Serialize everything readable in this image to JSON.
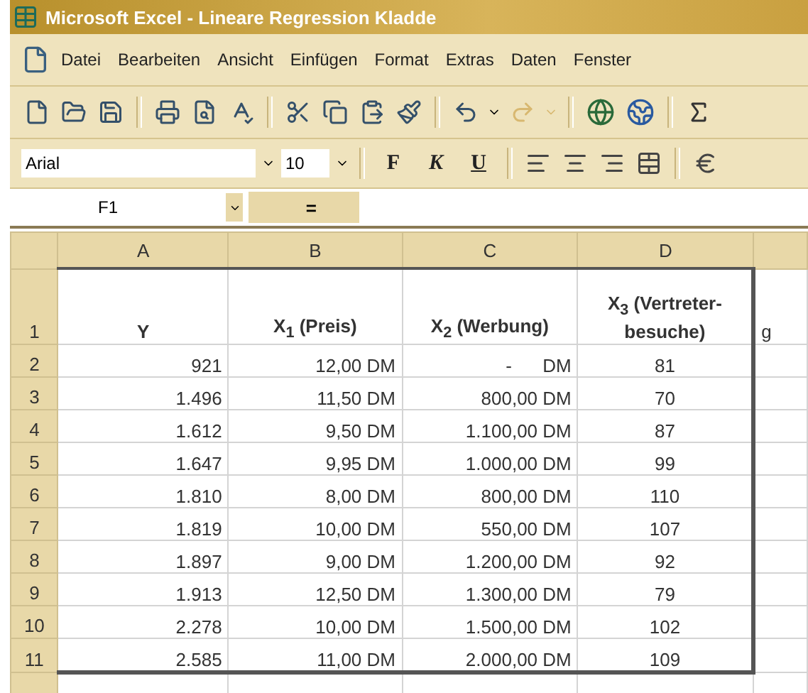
{
  "window": {
    "title": "Microsoft Excel - Lineare Regression Kladde"
  },
  "menu": [
    "Datei",
    "Bearbeiten",
    "Ansicht",
    "Einfügen",
    "Format",
    "Extras",
    "Daten",
    "Fenster"
  ],
  "standard_toolbar": {
    "redo": {
      "disabled": true
    }
  },
  "format_toolbar": {
    "font": "Arial",
    "size": "10",
    "bold": "F",
    "italic": "K",
    "underline": "U"
  },
  "formula_bar": {
    "name_box": "F1",
    "equals": "="
  },
  "sheet": {
    "columns": [
      "A",
      "B",
      "C",
      "D",
      ""
    ],
    "header_row": {
      "number": "1",
      "cells": [
        "Y",
        "X$_{1}$ (Preis)",
        "X$_{2}$ (Werbung)",
        "X$_{3}$ (Vertreter-besuche)",
        "g"
      ]
    },
    "rows": [
      {
        "number": "2",
        "cells": [
          "921",
          "12,00 DM",
          "-      DM",
          "81"
        ]
      },
      {
        "number": "3",
        "cells": [
          "1.496",
          "11,50 DM",
          "800,00 DM",
          "70"
        ]
      },
      {
        "number": "4",
        "cells": [
          "1.612",
          "9,50 DM",
          "1.100,00 DM",
          "87"
        ]
      },
      {
        "number": "5",
        "cells": [
          "1.647",
          "9,95 DM",
          "1.000,00 DM",
          "99"
        ]
      },
      {
        "number": "6",
        "cells": [
          "1.810",
          "8,00 DM",
          "800,00 DM",
          "110"
        ]
      },
      {
        "number": "7",
        "cells": [
          "1.819",
          "10,00 DM",
          "550,00 DM",
          "107"
        ]
      },
      {
        "number": "8",
        "cells": [
          "1.897",
          "9,00 DM",
          "1.200,00 DM",
          "92"
        ]
      },
      {
        "number": "9",
        "cells": [
          "1.913",
          "12,50 DM",
          "1.300,00 DM",
          "79"
        ]
      },
      {
        "number": "10",
        "cells": [
          "2.278",
          "10,00 DM",
          "1.500,00 DM",
          "102"
        ]
      },
      {
        "number": "11",
        "cells": [
          "2.585",
          "11,00 DM",
          "2.000,00 DM",
          "109"
        ]
      }
    ]
  }
}
